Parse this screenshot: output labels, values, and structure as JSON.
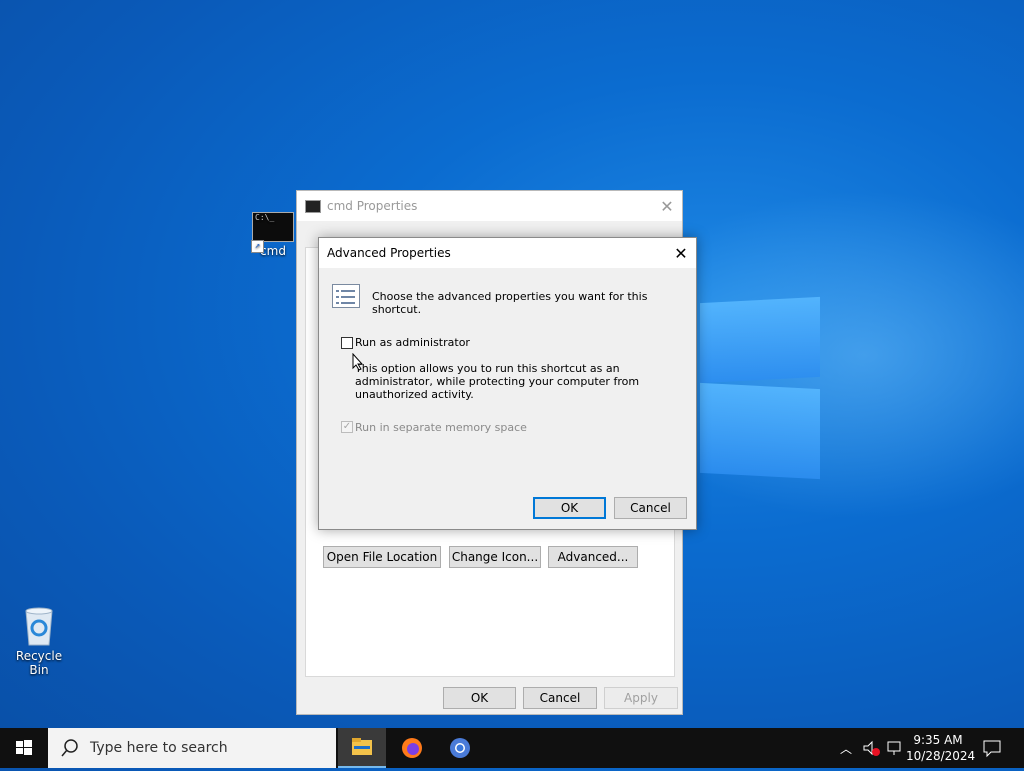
{
  "desktop": {
    "icons": [
      {
        "label": "cmd",
        "icon": "cmd-shortcut-icon"
      },
      {
        "label": "Recycle Bin",
        "icon": "recycle-bin-icon"
      }
    ]
  },
  "props_window": {
    "title": "cmd Properties",
    "buttons": {
      "open_file_location": "Open File Location",
      "change_icon": "Change Icon...",
      "advanced": "Advanced...",
      "ok": "OK",
      "cancel": "Cancel",
      "apply": "Apply"
    }
  },
  "advanced_dialog": {
    "title": "Advanced Properties",
    "header": "Choose the advanced properties you want for this shortcut.",
    "run_as_admin": {
      "label": "Run as administrator",
      "checked": false
    },
    "description_lines": [
      "This option allows you to run this shortcut as an",
      "administrator, while protecting your computer from",
      "unauthorized activity."
    ],
    "separate_memory": {
      "label": "Run in separate memory space",
      "checked": true,
      "disabled": true
    },
    "ok_label": "OK",
    "cancel_label": "Cancel"
  },
  "taskbar": {
    "search_placeholder": "Type here to search",
    "apps": [
      "file-explorer-icon",
      "firefox-icon",
      "chrome-icon"
    ],
    "clock_time": "9:35 AM",
    "clock_date": "10/28/2024"
  },
  "colors": {
    "desktop_blue": "#0b6cd0",
    "accent": "#0078d7",
    "taskbar": "#101010"
  }
}
